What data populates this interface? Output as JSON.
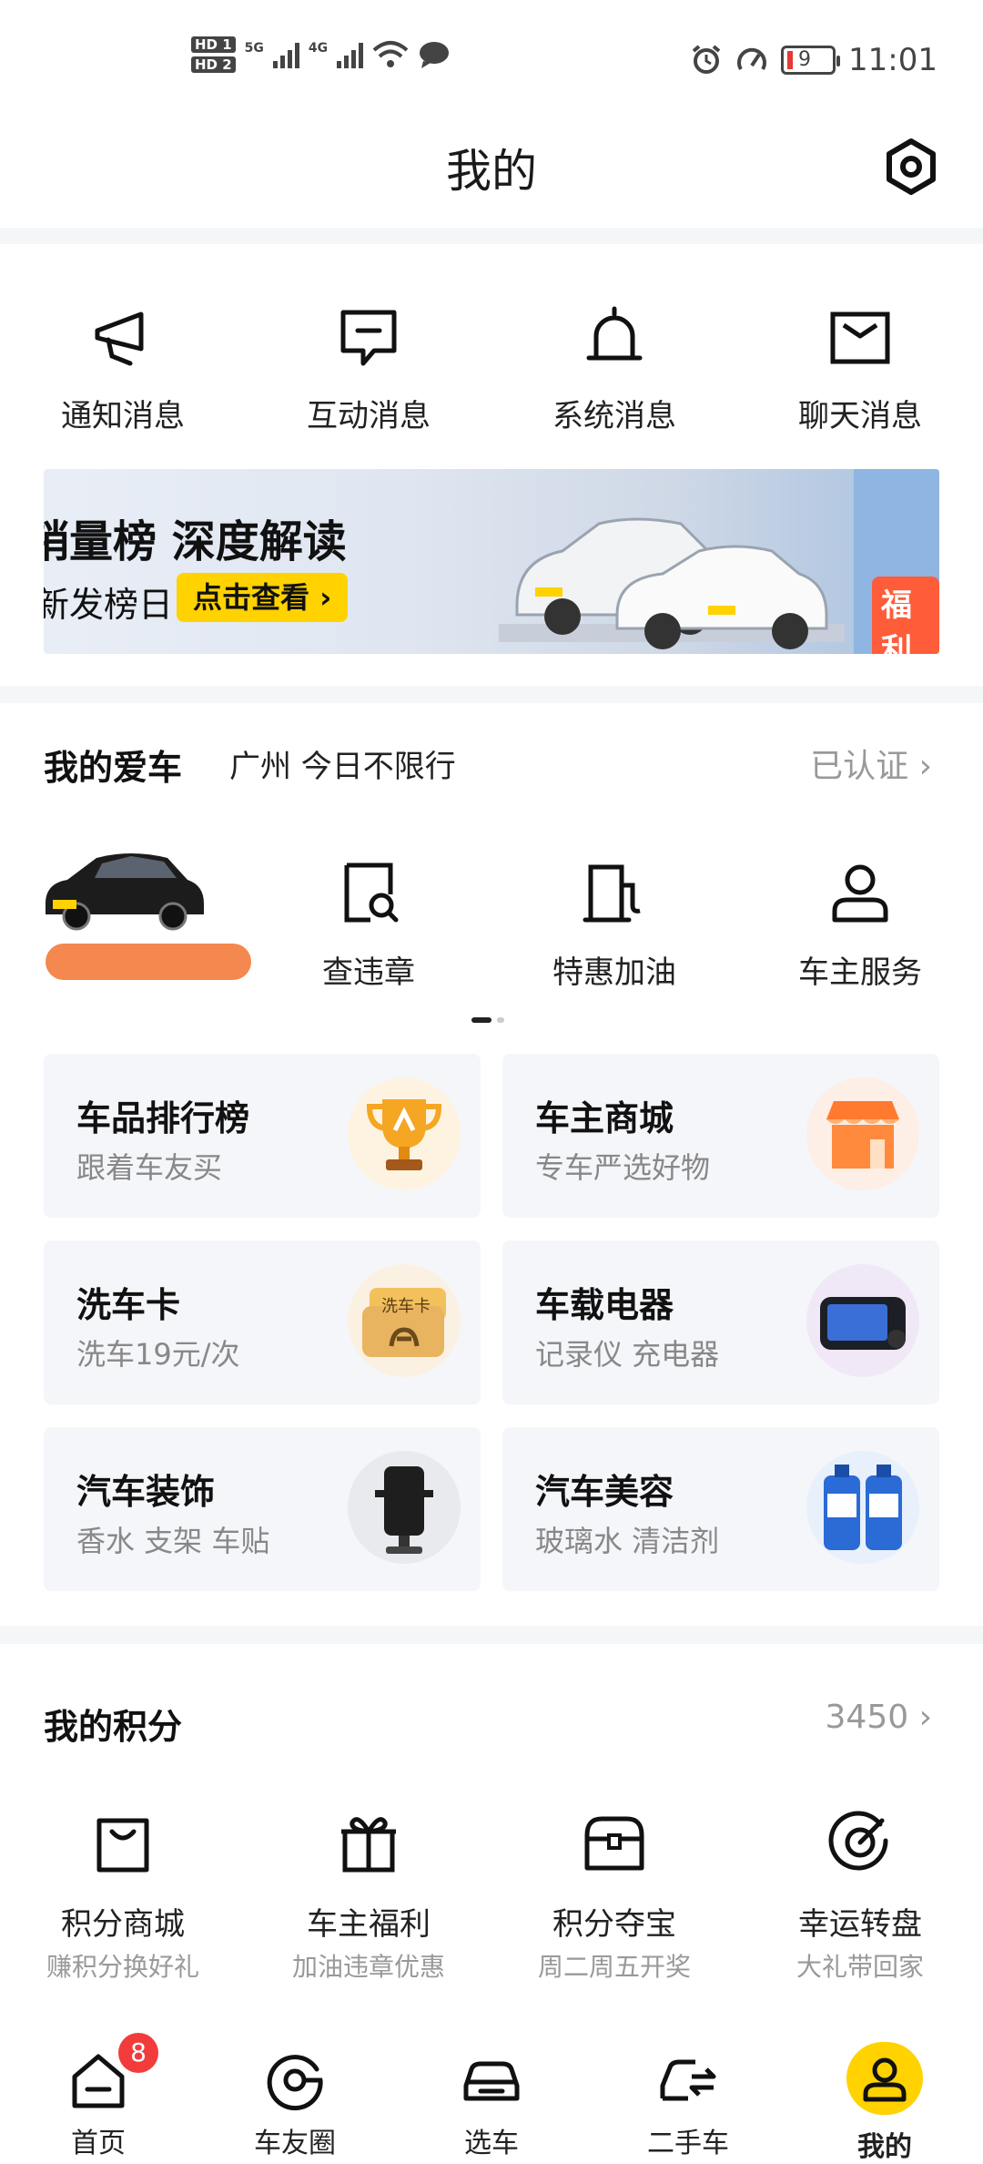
{
  "status_bar": {
    "hd1": "HD 1",
    "hd2": "HD 2",
    "net1": "5G",
    "net2": "4G",
    "battery": "9",
    "time": "11:01"
  },
  "header": {
    "title": "我的"
  },
  "messages": [
    {
      "label": "通知消息",
      "icon": "megaphone-icon"
    },
    {
      "label": "互动消息",
      "icon": "chat-bubble-icon"
    },
    {
      "label": "系统消息",
      "icon": "bell-icon"
    },
    {
      "label": "聊天消息",
      "icon": "envelope-icon"
    }
  ],
  "banner": {
    "title": "销量榜  深度解读",
    "subtitle": "新发榜日",
    "button": "点击查看 ›",
    "side_tag": "福利"
  },
  "my_car": {
    "title": "我的爱车",
    "city": "广州  今日不限行",
    "status": "已认证 ›",
    "actions": [
      {
        "label": "查违章",
        "icon": "violation-search-icon"
      },
      {
        "label": "特惠加油",
        "icon": "fuel-pump-icon"
      },
      {
        "label": "车主服务",
        "icon": "user-service-icon"
      }
    ]
  },
  "services": [
    {
      "title": "车品排行榜",
      "subtitle": "跟着车友买",
      "icon": "trophy-icon"
    },
    {
      "title": "车主商城",
      "subtitle": "专车严选好物",
      "icon": "store-icon"
    },
    {
      "title": "洗车卡",
      "subtitle": "洗车19元/次",
      "icon": "wash-card-icon",
      "icon_text": "洗车卡"
    },
    {
      "title": "车载电器",
      "subtitle": "记录仪 充电器",
      "icon": "dashcam-icon"
    },
    {
      "title": "汽车装饰",
      "subtitle": "香水 支架 车贴",
      "icon": "phone-holder-icon"
    },
    {
      "title": "汽车美容",
      "subtitle": "玻璃水 清洁剂",
      "icon": "washer-fluid-icon"
    }
  ],
  "points": {
    "title": "我的积分",
    "value": "3450 ›",
    "items": [
      {
        "label": "积分商城",
        "sub": "赚积分换好礼",
        "icon": "shopping-bag-icon"
      },
      {
        "label": "车主福利",
        "sub": "加油违章优惠",
        "icon": "gift-icon"
      },
      {
        "label": "积分夺宝",
        "sub": "周二周五开奖",
        "icon": "treasure-box-icon"
      },
      {
        "label": "幸运转盘",
        "sub": "大礼带回家",
        "icon": "lucky-wheel-icon"
      }
    ]
  },
  "bottom_nav": {
    "items": [
      {
        "label": "首页",
        "icon": "home-icon",
        "badge": "8"
      },
      {
        "label": "车友圈",
        "icon": "community-icon"
      },
      {
        "label": "选车",
        "icon": "car-icon"
      },
      {
        "label": "二手车",
        "icon": "used-car-icon"
      },
      {
        "label": "我的",
        "icon": "profile-icon",
        "active": true
      }
    ]
  },
  "colors": {
    "accent": "#ffd200",
    "badge": "#f23c3c",
    "muted": "#999999"
  }
}
